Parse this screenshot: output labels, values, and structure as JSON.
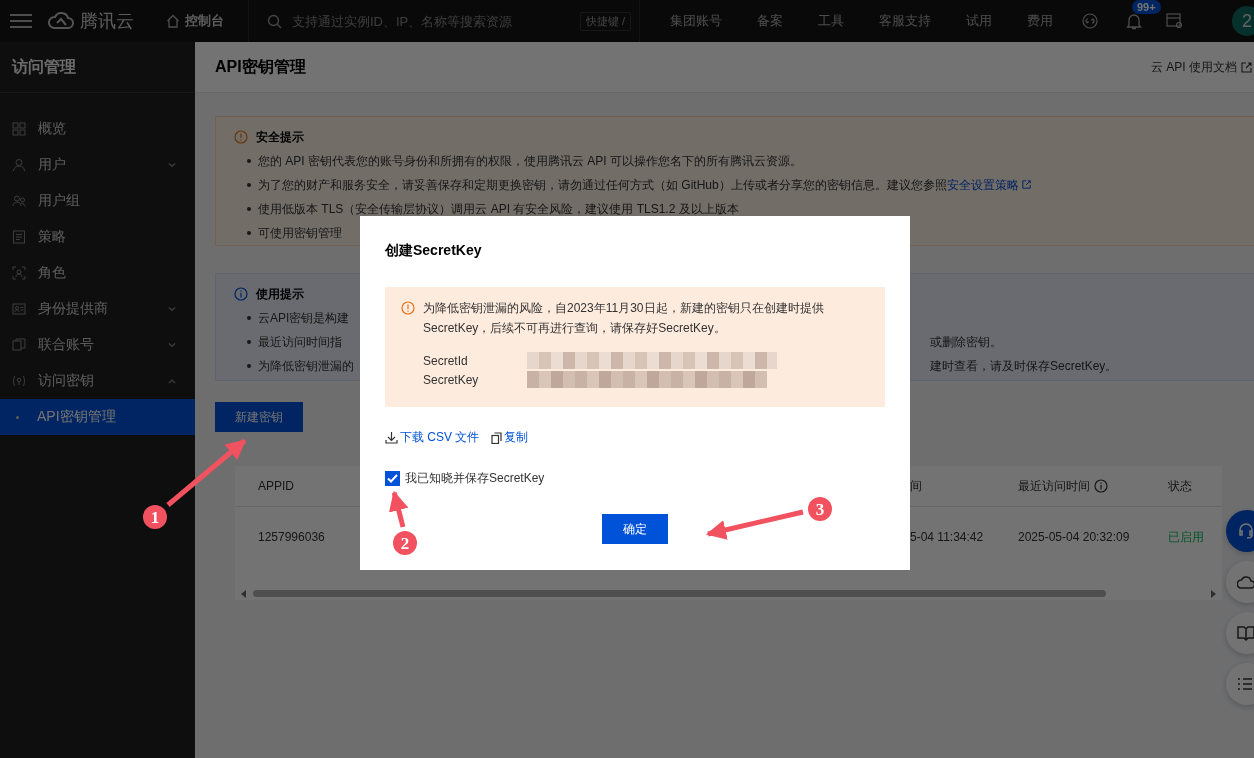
{
  "topbar": {
    "brand": "腾讯云",
    "console": "控制台",
    "search": {
      "placeholder": "支持通过实例ID、IP、名称等搜索资源"
    },
    "shortcut": "快捷键 /",
    "nav": [
      "集团账号",
      "备案",
      "工具",
      "客服支持",
      "试用",
      "费用"
    ],
    "notifications": "99+",
    "avatar": "2"
  },
  "sidebar": {
    "title": "访问管理",
    "items": [
      {
        "label": "概览",
        "selected": false
      },
      {
        "label": "用户",
        "selected": false,
        "expanded": false
      },
      {
        "label": "用户组",
        "selected": false
      },
      {
        "label": "策略",
        "selected": false
      },
      {
        "label": "角色",
        "selected": false
      },
      {
        "label": "身份提供商",
        "selected": false,
        "expanded": false
      },
      {
        "label": "联合账号",
        "selected": false,
        "expanded": false
      },
      {
        "label": "访问密钥",
        "selected": false,
        "expanded": true,
        "children": [
          {
            "label": "API密钥管理",
            "selected": true
          }
        ]
      }
    ]
  },
  "page": {
    "title": "API密钥管理",
    "doc_link": "云 API 使用文档",
    "security": {
      "title": "安全提示",
      "bullets": [
        "您的 API 密钥代表您的账号身份和所拥有的权限，使用腾讯云 API 可以操作您名下的所有腾讯云资源。",
        "为了您的财产和服务安全，请妥善保存和定期更换密钥，请勿通过任何方式（如 GitHub）上传或者分享您的密钥信息。建议您参照",
        "使用低版本 TLS（安全传输层协议）调用云 API 有安全风险，建议使用 TLS1.2 及以上版本",
        "可使用密钥管理"
      ],
      "link": "安全设置策略"
    },
    "usage": {
      "title": "使用提示",
      "bullets": [
        {
          "left": "云API密钥是构建"
        },
        {
          "left": "最近访问时间指",
          "right": "或删除密钥。"
        },
        {
          "left": "为降低密钥泄漏的",
          "right": "建时查看，请及时保存SecretKey。"
        }
      ]
    },
    "new_button": "新建密钥",
    "table": {
      "columns": [
        "APPID",
        "间",
        "最近访问时间",
        "状态"
      ],
      "rows": [
        {
          "cells": [
            "1257996036",
            "5-04 11:34:42",
            "2025-05-04 20:32:09",
            "已启用"
          ]
        }
      ]
    }
  },
  "modal": {
    "title": "创建SecretKey",
    "warning": "为降低密钥泄漏的风险，自2023年11月30日起，新建的密钥只在创建时提供SecretKey，后续不可再进行查询，请保存好SecretKey。",
    "fields": [
      {
        "label": "SecretId"
      },
      {
        "label": "SecretKey"
      }
    ],
    "download": "下载 CSV 文件",
    "copy": "复制",
    "ack": {
      "label": "我已知晓并保存SecretKey",
      "checked": true
    },
    "ok": "确定"
  },
  "annotations": [
    {
      "number": "1"
    },
    {
      "number": "2"
    },
    {
      "number": "3"
    }
  ]
}
